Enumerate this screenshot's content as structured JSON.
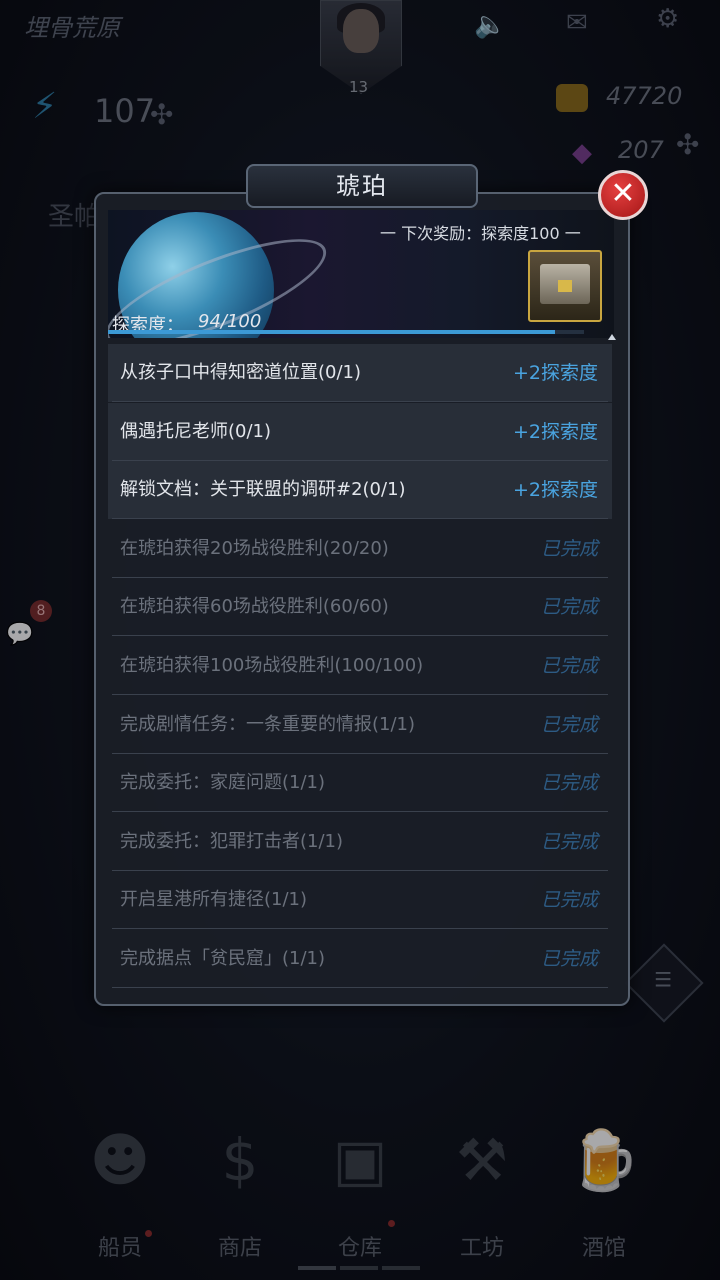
{
  "hud": {
    "region_name": "埋骨荒原",
    "player_level": "13",
    "energy": "107",
    "gold": "47720",
    "gems": "207",
    "side_location": "圣帕",
    "chat_badge": "8"
  },
  "dialog": {
    "title": "琥珀",
    "close_label": "✕",
    "next_reward": "一 下次奖励：探索度100 一",
    "explore_label": "探索度：",
    "explore_value": "94/100",
    "progress_fraction": 0.94,
    "tasks": [
      {
        "text": "从孩子口中得知密道位置(0/1)",
        "reward": "+2探索度",
        "state": "active"
      },
      {
        "text": "偶遇托尼老师(0/1)",
        "reward": "+2探索度",
        "state": "active"
      },
      {
        "text": "解锁文档：关于联盟的调研#2(0/1)",
        "reward": "+2探索度",
        "state": "active"
      },
      {
        "text": "在琥珀获得20场战役胜利(20/20)",
        "reward": "已完成",
        "state": "done"
      },
      {
        "text": "在琥珀获得60场战役胜利(60/60)",
        "reward": "已完成",
        "state": "done"
      },
      {
        "text": "在琥珀获得100场战役胜利(100/100)",
        "reward": "已完成",
        "state": "done"
      },
      {
        "text": "完成剧情任务：一条重要的情报(1/1)",
        "reward": "已完成",
        "state": "done"
      },
      {
        "text": "完成委托：家庭问题(1/1)",
        "reward": "已完成",
        "state": "done"
      },
      {
        "text": "完成委托：犯罪打击者(1/1)",
        "reward": "已完成",
        "state": "done"
      },
      {
        "text": "开启星港所有捷径(1/1)",
        "reward": "已完成",
        "state": "done"
      },
      {
        "text": "完成据点「贫民窟」(1/1)",
        "reward": "已完成",
        "state": "done"
      }
    ]
  },
  "nav": {
    "items": [
      {
        "label": "船员",
        "icon": "crew-icon",
        "badge": true
      },
      {
        "label": "商店",
        "icon": "shop-icon",
        "badge": false
      },
      {
        "label": "仓库",
        "icon": "storage-icon",
        "badge": true
      },
      {
        "label": "工坊",
        "icon": "workshop-icon",
        "badge": false
      },
      {
        "label": "酒馆",
        "icon": "tavern-icon",
        "badge": false
      }
    ]
  },
  "colors": {
    "accent_blue": "#4aa4e0",
    "close_red": "#c42222",
    "done_text": "#2d5b84"
  }
}
